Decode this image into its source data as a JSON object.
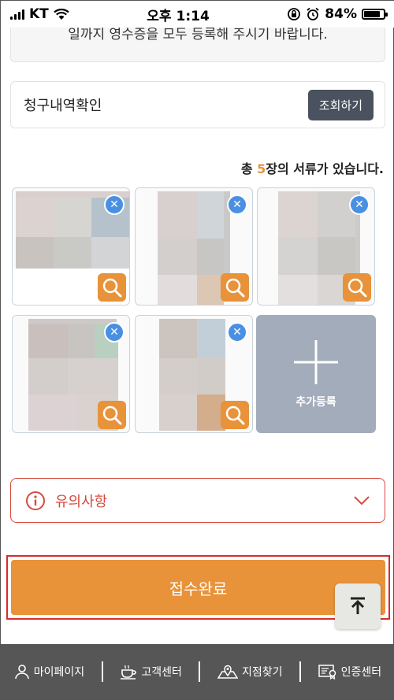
{
  "status_bar": {
    "carrier": "KT",
    "time": "오후 1:14",
    "battery": "84%",
    "battery_level": 0.84
  },
  "notice": {
    "text": "일까지 영수증을 모두 등록해 주시기 바랍니다."
  },
  "claim_history": {
    "title": "청구내역확인",
    "button_label": "조회하기"
  },
  "documents": {
    "count_prefix": "총 ",
    "count": "5",
    "count_suffix": "장의 서류가 있습니다."
  },
  "add_document": {
    "label": "추가등록"
  },
  "caution": {
    "label": "유의사항"
  },
  "submit": {
    "label": "접수완료"
  },
  "colors": {
    "accent_orange": "#e8923a",
    "delete_blue": "#4a90e2",
    "caution_red": "#d64a3e",
    "nav_gray": "#565656"
  },
  "bottom_nav": {
    "items": [
      {
        "label": "마이페이지",
        "icon": "person-icon"
      },
      {
        "label": "고객센터",
        "icon": "cup-icon"
      },
      {
        "label": "지점찾기",
        "icon": "map-pin-icon"
      },
      {
        "label": "인증센터",
        "icon": "certificate-icon"
      }
    ]
  }
}
